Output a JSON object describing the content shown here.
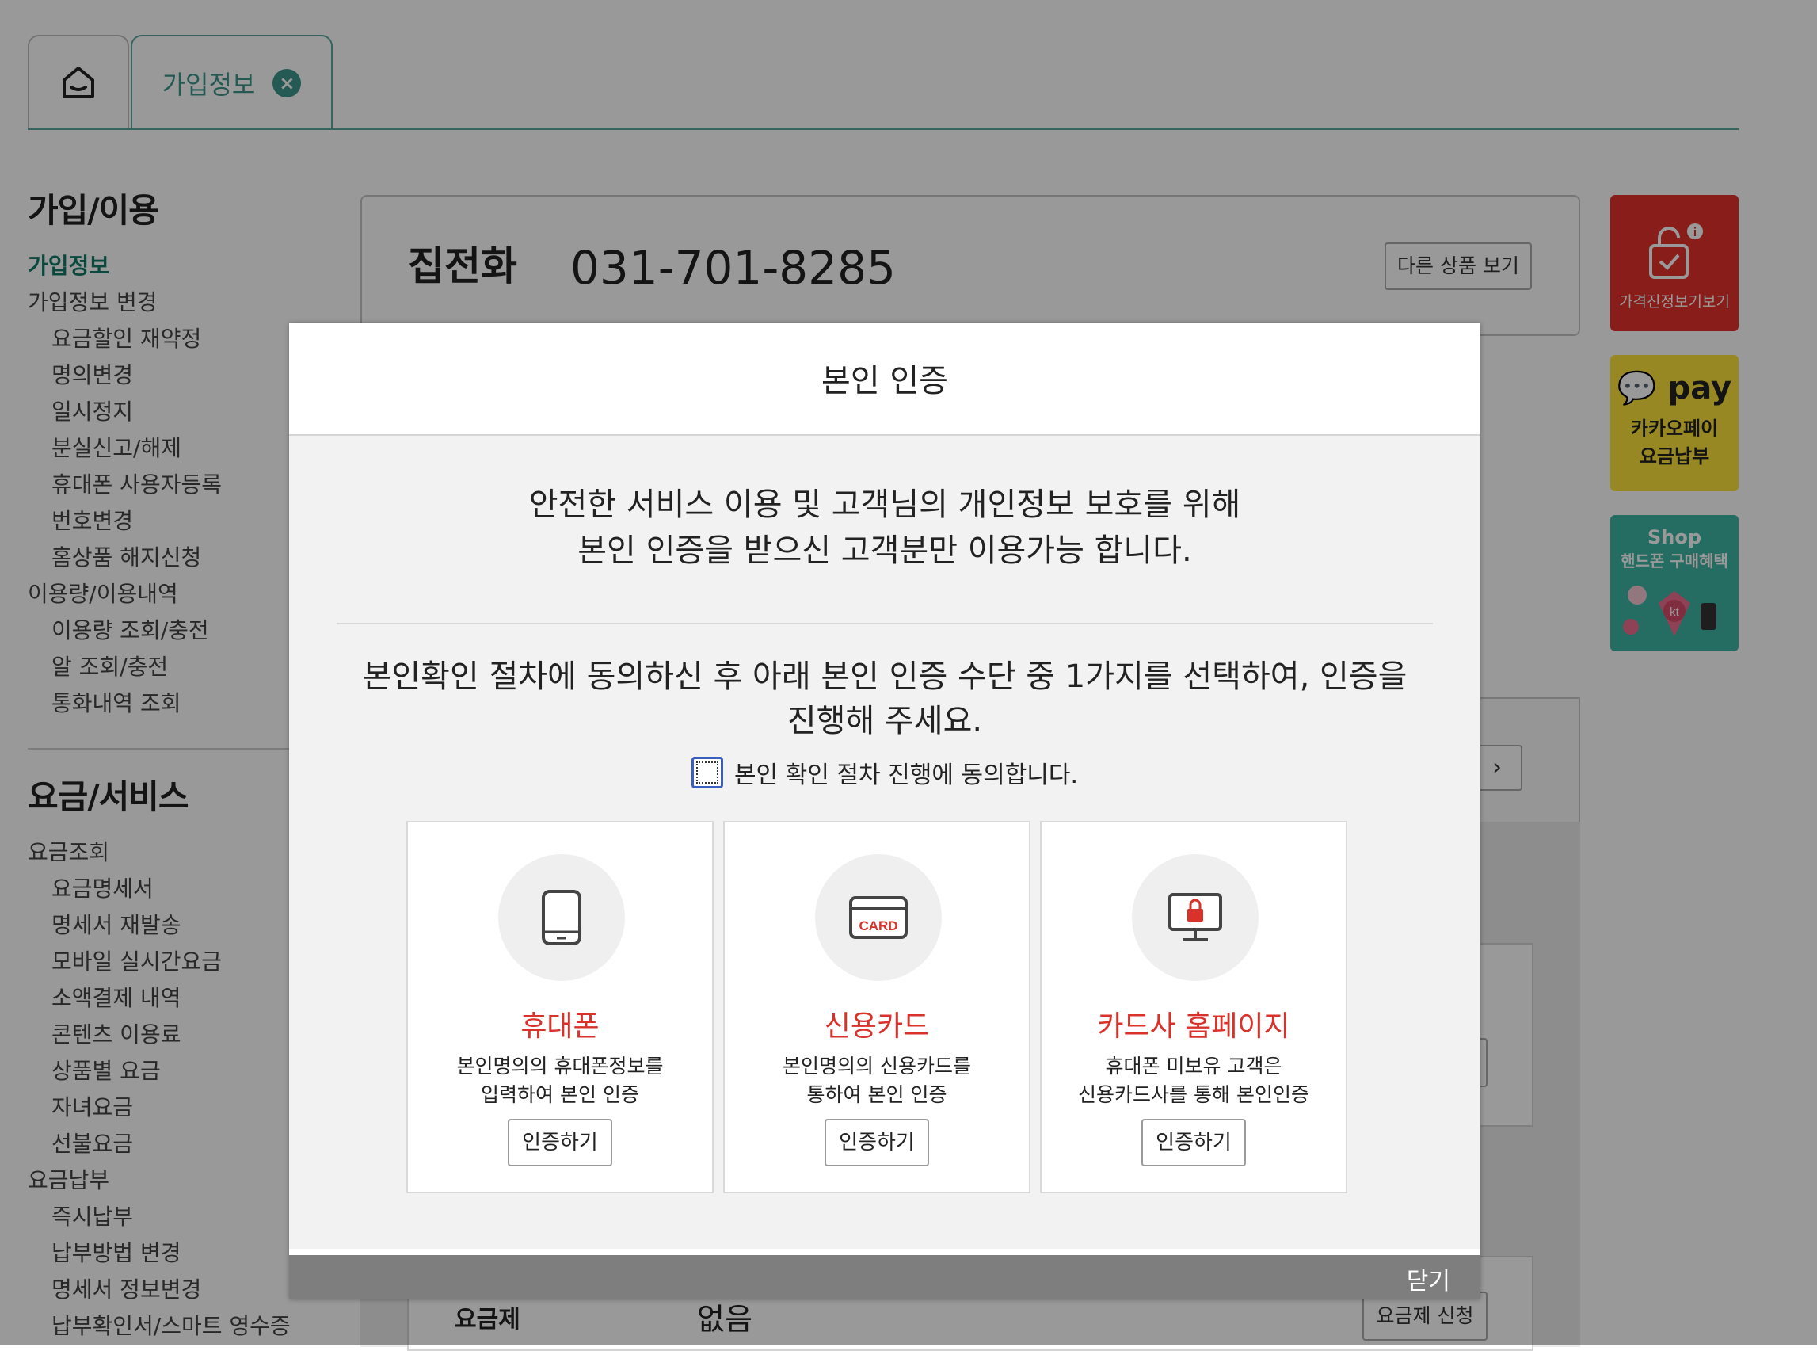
{
  "tabs": {
    "home_icon": "home-icon",
    "active_label": "가입정보",
    "close_icon": "close-icon"
  },
  "sidebar": {
    "section1_title": "가입/이용",
    "section1_items": [
      {
        "label": "가입정보",
        "level": 1,
        "active": true
      },
      {
        "label": "가입정보 변경",
        "level": 1
      },
      {
        "label": "요금할인 재약정",
        "level": 2
      },
      {
        "label": "명의변경",
        "level": 2
      },
      {
        "label": "일시정지",
        "level": 2
      },
      {
        "label": "분실신고/해제",
        "level": 2
      },
      {
        "label": "휴대폰 사용자등록",
        "level": 2
      },
      {
        "label": "번호변경",
        "level": 2
      },
      {
        "label": "홈상품 해지신청",
        "level": 2
      },
      {
        "label": "이용량/이용내역",
        "level": 1
      },
      {
        "label": "이용량 조회/충전",
        "level": 2
      },
      {
        "label": "알 조회/충전",
        "level": 2
      },
      {
        "label": "통화내역 조회",
        "level": 2
      }
    ],
    "section2_title": "요금/서비스",
    "section2_items": [
      {
        "label": "요금조회",
        "level": 1
      },
      {
        "label": "요금명세서",
        "level": 2
      },
      {
        "label": "명세서 재발송",
        "level": 2
      },
      {
        "label": "모바일 실시간요금",
        "level": 2
      },
      {
        "label": "소액결제 내역",
        "level": 2
      },
      {
        "label": "콘텐츠 이용료",
        "level": 2
      },
      {
        "label": "상품별 요금",
        "level": 2
      },
      {
        "label": "자녀요금",
        "level": 2
      },
      {
        "label": "선불요금",
        "level": 2
      },
      {
        "label": "요금납부",
        "level": 1
      },
      {
        "label": "즉시납부",
        "level": 2
      },
      {
        "label": "납부방법 변경",
        "level": 2
      },
      {
        "label": "명세서 정보변경",
        "level": 2
      },
      {
        "label": "납부확인서/스마트 영수증",
        "level": 2
      }
    ]
  },
  "product": {
    "name": "집전화",
    "number": "031-701-8285",
    "other_button": "다른 상품 보기",
    "plan_label": "요금제",
    "plan_value": "없음",
    "plan_button": "요금제 신청"
  },
  "banners": {
    "price_info": "가격진정보기보기",
    "kakaopay_logo": "pay",
    "kakaopay_line1": "카카오페이",
    "kakaopay_line2": "요금납부",
    "shop_title": "Shop",
    "shop_sub": "핸드폰 구매혜택",
    "shop_logo": "kt"
  },
  "modal": {
    "title": "본인 인증",
    "desc_line1": "안전한 서비스 이용 및 고객님의 개인정보 보호를 위해",
    "desc_line2": "본인 인증을 받으신 고객분만 이용가능 합니다.",
    "instruction_line1": "본인확인 절차에 동의하신 후 아래 본인 인증 수단 중 1가지를 선택하여, 인증을",
    "instruction_line2": "진행해 주세요.",
    "agree_label": "본인 확인 절차 진행에 동의합니다.",
    "cards": [
      {
        "icon": "phone-icon",
        "title": "휴대폰",
        "desc1": "본인명의의 휴대폰정보를",
        "desc2": "입력하여 본인 인증",
        "button": "인증하기"
      },
      {
        "icon": "credit-card-icon",
        "card_text": "CARD",
        "title": "신용카드",
        "desc1": "본인명의의 신용카드를",
        "desc2": "통하여 본인 인증",
        "button": "인증하기"
      },
      {
        "icon": "monitor-lock-icon",
        "title": "카드사 홈페이지",
        "desc1": "휴대폰 미보유 고객은",
        "desc2": "신용카드사를 통해 본인인증",
        "button": "인증하기"
      }
    ],
    "close_label": "닫기"
  },
  "colors": {
    "accent": "#3f948a",
    "active_text": "#137a6a",
    "card_title": "#d9322a",
    "overlay": "rgba(0,0,0,0.40)"
  }
}
